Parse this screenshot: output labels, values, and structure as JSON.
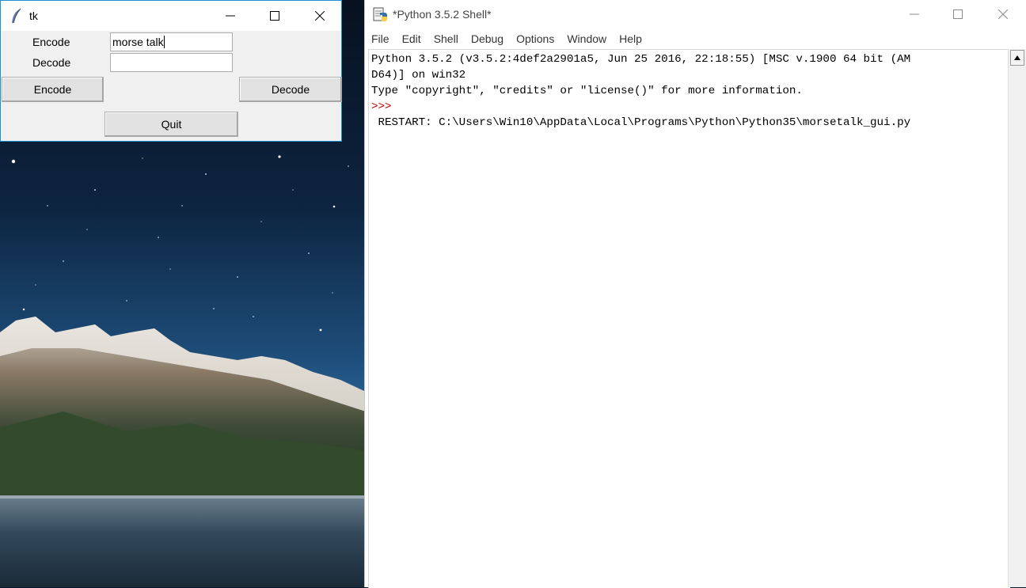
{
  "tk_window": {
    "title": "tk",
    "encode_label": "Encode",
    "decode_label": "Decode",
    "encode_input_value": "morse talk",
    "decode_input_value": "",
    "encode_button": "Encode",
    "decode_button": "Decode",
    "quit_button": "Quit",
    "icons": [
      "feather-icon",
      "minimize-icon",
      "maximize-icon",
      "close-icon"
    ]
  },
  "idle_window": {
    "title": "*Python 3.5.2 Shell*",
    "menu": [
      "File",
      "Edit",
      "Shell",
      "Debug",
      "Options",
      "Window",
      "Help"
    ],
    "shell_lines": [
      "Python 3.5.2 (v3.5.2:4def2a2901a5, Jun 25 2016, 22:18:55) [MSC v.1900 64 bit (AM",
      "D64)] on win32",
      "Type \"copyright\", \"credits\" or \"license()\" for more information.",
      ">>>",
      " RESTART: C:\\Users\\Win10\\AppData\\Local\\Programs\\Python\\Python35\\morsetalk_gui.py"
    ],
    "icons": [
      "python-idle-icon",
      "minimize-icon",
      "maximize-icon",
      "close-icon",
      "scroll-up-icon"
    ]
  },
  "colors": {
    "prompt": "#c00000",
    "tk_border": "#1e90d0",
    "window_bg": "#f0f0f0"
  }
}
